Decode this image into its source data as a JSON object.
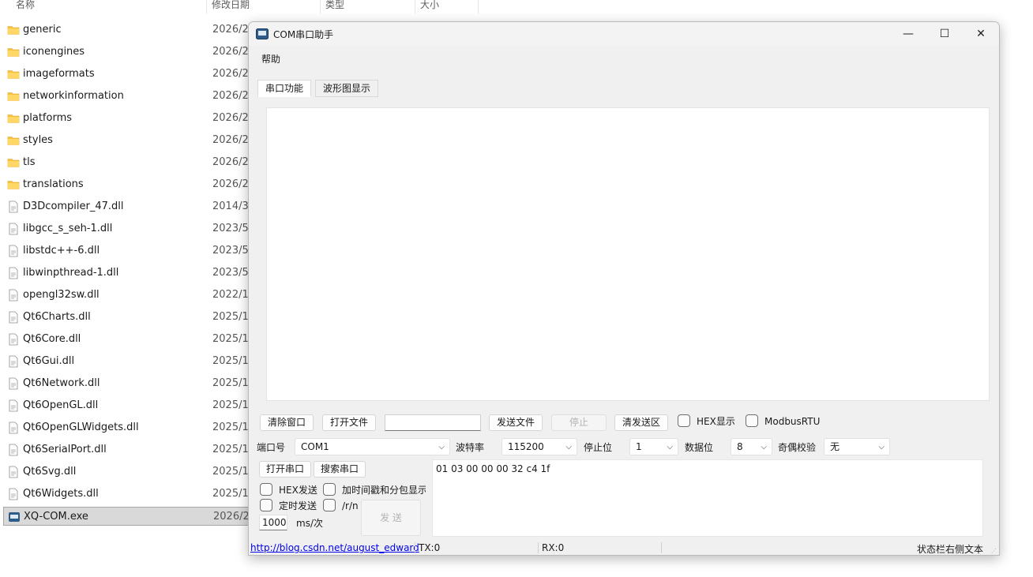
{
  "explorer": {
    "columns": [
      "名称",
      "修改日期",
      "类型",
      "大小"
    ],
    "files": [
      {
        "name": "generic",
        "date": "2026/2/",
        "kind": "folder"
      },
      {
        "name": "iconengines",
        "date": "2026/2/",
        "kind": "folder"
      },
      {
        "name": "imageformats",
        "date": "2026/2/",
        "kind": "folder"
      },
      {
        "name": "networkinformation",
        "date": "2026/2/",
        "kind": "folder"
      },
      {
        "name": "platforms",
        "date": "2026/2/",
        "kind": "folder"
      },
      {
        "name": "styles",
        "date": "2026/2/",
        "kind": "folder"
      },
      {
        "name": "tls",
        "date": "2026/2/",
        "kind": "folder"
      },
      {
        "name": "translations",
        "date": "2026/2/",
        "kind": "folder"
      },
      {
        "name": "D3Dcompiler_47.dll",
        "date": "2014/3/",
        "kind": "file"
      },
      {
        "name": "libgcc_s_seh-1.dll",
        "date": "2023/5/",
        "kind": "file"
      },
      {
        "name": "libstdc++-6.dll",
        "date": "2023/5/",
        "kind": "file"
      },
      {
        "name": "libwinpthread-1.dll",
        "date": "2023/5/",
        "kind": "file"
      },
      {
        "name": "opengl32sw.dll",
        "date": "2022/11",
        "kind": "file"
      },
      {
        "name": "Qt6Charts.dll",
        "date": "2025/11",
        "kind": "file"
      },
      {
        "name": "Qt6Core.dll",
        "date": "2025/11",
        "kind": "file"
      },
      {
        "name": "Qt6Gui.dll",
        "date": "2025/11",
        "kind": "file"
      },
      {
        "name": "Qt6Network.dll",
        "date": "2025/11",
        "kind": "file"
      },
      {
        "name": "Qt6OpenGL.dll",
        "date": "2025/11",
        "kind": "file"
      },
      {
        "name": "Qt6OpenGLWidgets.dll",
        "date": "2025/11",
        "kind": "file"
      },
      {
        "name": "Qt6SerialPort.dll",
        "date": "2025/11",
        "kind": "file"
      },
      {
        "name": "Qt6Svg.dll",
        "date": "2025/11",
        "kind": "file"
      },
      {
        "name": "Qt6Widgets.dll",
        "date": "2025/11",
        "kind": "file"
      },
      {
        "name": "XQ-COM.exe",
        "date": "2026/2/",
        "kind": "exe",
        "selected": true
      }
    ],
    "folder_icon_color": "#f4c542"
  },
  "window": {
    "title": "COM串口助手",
    "controls": {
      "minimize": "—",
      "maximize": "☐",
      "close": "✕"
    },
    "menu": {
      "help": "帮助"
    },
    "tabs": [
      {
        "label": "串口功能",
        "active": true
      },
      {
        "label": "波形图显示",
        "active": false
      }
    ],
    "toolbar": {
      "clear_window": "清除窗口",
      "open_file": "打开文件",
      "file_path": "",
      "send_file": "发送文件",
      "stop": "停止",
      "clear_send": "清发送区",
      "hex_display": "HEX显示",
      "modbus_rtu": "ModbusRTU"
    },
    "serial": {
      "port_label": "端口号",
      "port_value": "COM1",
      "baud_label": "波特率",
      "baud_value": "115200",
      "stop_label": "停止位",
      "stop_value": "1",
      "data_label": "数据位",
      "data_value": "8",
      "parity_label": "奇偶校验",
      "parity_value": "无"
    },
    "send_panel": {
      "open_port": "打开串口",
      "search_port": "搜索串口",
      "hex_send": "HEX发送",
      "timestamp": "加时间戳和分包显示",
      "timed_send": "定时发送",
      "crlf": "/r/n",
      "interval": "1000",
      "interval_unit": "ms/次",
      "send": "发 送",
      "send_text": "01 03 00 00 00 32 c4 1f"
    },
    "status": {
      "link": "http://blog.csdn.net/august_edward",
      "tx": "TX:0",
      "rx": "RX:0",
      "right_text": "状态栏右侧文本"
    },
    "accent_link": "#0000ee"
  }
}
